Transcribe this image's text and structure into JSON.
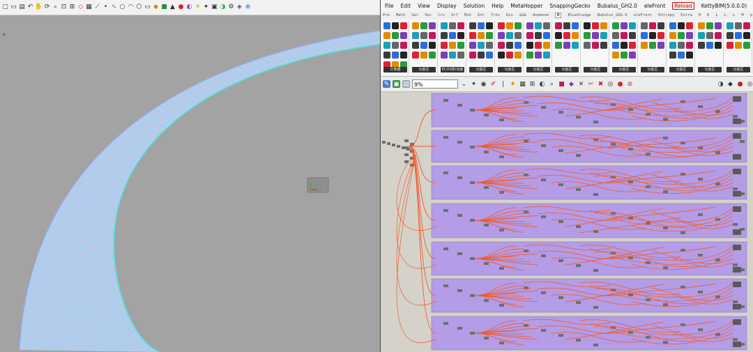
{
  "rhino": {
    "toolbar_icons": [
      "new-file",
      "open-file",
      "save-file",
      "undo",
      "pan",
      "rotate",
      "zoom-window",
      "zoom-extents",
      "zoom-selected",
      "select",
      "grid",
      "lines",
      "points",
      "curves",
      "circle",
      "arc",
      "polygon",
      "rectangle",
      "surface",
      "solid",
      "mesh",
      "render",
      "material",
      "light",
      "analysis",
      "layer",
      "display",
      "properties",
      "named-view",
      "snap"
    ],
    "viewport_marker": "+"
  },
  "gh": {
    "menu": [
      "File",
      "Edit",
      "View",
      "Display",
      "Solution",
      "Help",
      "MetaHopper",
      "SnappingGecko",
      "Bubalus_GH2.0",
      "eleFront",
      "Reload",
      "KettyBIM(5.0.0.0)"
    ],
    "reload_label": "Reload",
    "tabs": [
      "Pre",
      "Math",
      "Set",
      "Vec",
      "Crv",
      "Srf",
      "Msh",
      "Int",
      "Trns",
      "Dis",
      "&&&",
      "Anemone",
      "B",
      "BlueOrange",
      "Bubalus_GH2.0",
      "eleFront",
      "Entropy",
      "Extra",
      "H",
      "E",
      "L",
      "L",
      "L",
      "M",
      "p",
      "p"
    ],
    "active_tab": "B",
    "ribbon_groups": [
      {
        "label": "计算器"
      },
      {
        "label": "功能区"
      },
      {
        "label": "ECOS类/功能"
      },
      {
        "label": "功能区"
      },
      {
        "label": "功能区"
      },
      {
        "label": "功能区"
      },
      {
        "label": "功能区"
      },
      {
        "label": "功能区"
      },
      {
        "label": "功能区"
      },
      {
        "label": "功能区"
      },
      {
        "label": "功能区"
      },
      {
        "label": "功能区"
      },
      {
        "label": "功能区"
      }
    ],
    "zoom": "9%",
    "accent_colors": {
      "group_fill": "#b49ce6",
      "wire": "#f25a2a",
      "canvas": "#d5d2ca",
      "node": "#6e6e6e"
    }
  }
}
